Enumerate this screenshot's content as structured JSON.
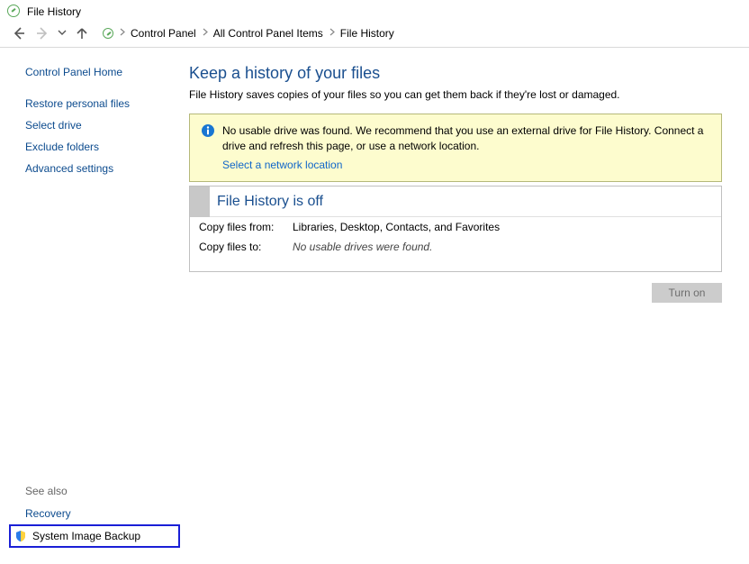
{
  "window": {
    "title": "File History"
  },
  "breadcrumb": {
    "items": [
      "Control Panel",
      "All Control Panel Items",
      "File History"
    ]
  },
  "sidebar": {
    "home": "Control Panel Home",
    "links": [
      "Restore personal files",
      "Select drive",
      "Exclude folders",
      "Advanced settings"
    ],
    "see_also_label": "See also",
    "see_also": [
      "Recovery",
      "System Image Backup"
    ]
  },
  "main": {
    "heading": "Keep a history of your files",
    "subtext": "File History saves copies of your files so you can get them back if they're lost or damaged.",
    "alert": {
      "message": "No usable drive was found. We recommend that you use an external drive for File History. Connect a drive and refresh this page, or use a network location.",
      "link": "Select a network location"
    },
    "status": {
      "title": "File History is off",
      "rows": [
        {
          "key": "Copy files from:",
          "val": "Libraries, Desktop, Contacts, and Favorites",
          "italic": false
        },
        {
          "key": "Copy files to:",
          "val": "No usable drives were found.",
          "italic": true
        }
      ]
    },
    "action": {
      "turn_on": "Turn on"
    }
  }
}
